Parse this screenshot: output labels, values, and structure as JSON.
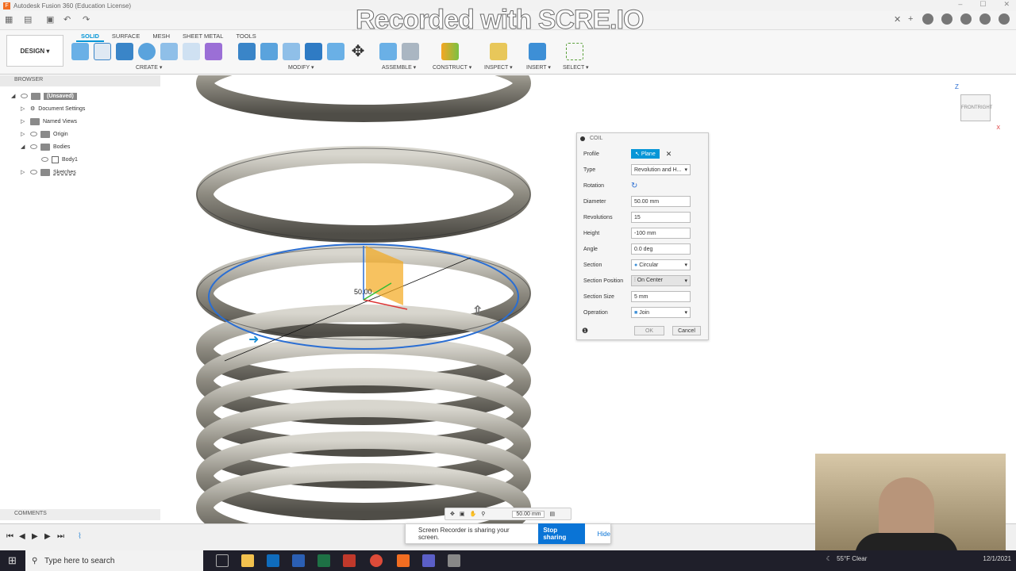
{
  "window": {
    "title": "Autodesk Fusion 360 (Education License)",
    "watermark": "Recorded with SCRE.IO"
  },
  "toolbar": {
    "workspace": "DESIGN ▾",
    "tabs": [
      "SOLID",
      "SURFACE",
      "MESH",
      "SHEET METAL",
      "TOOLS"
    ],
    "groups": [
      "CREATE ▾",
      "MODIFY ▾",
      "ASSEMBLE ▾",
      "CONSTRUCT ▾",
      "INSPECT ▾",
      "INSERT ▾",
      "SELECT ▾"
    ]
  },
  "browser": {
    "title": "BROWSER",
    "items": [
      "(Unsaved)",
      "Document Settings",
      "Named Views",
      "Origin",
      "Bodies",
      "Body1",
      "Sketches"
    ]
  },
  "comments": "COMMENTS",
  "viewcube": {
    "axis_z": "Z",
    "front": "FRONT",
    "right": "RIGHT",
    "axis_x": "X"
  },
  "canvas": {
    "dim_label": "50.00"
  },
  "navbar": {
    "value": "50.00 mm"
  },
  "coil": {
    "title": "COIL",
    "rows": [
      {
        "label": "Profile",
        "value": "Plane"
      },
      {
        "label": "Type",
        "value": "Revolution and H..."
      },
      {
        "label": "Rotation",
        "value": ""
      },
      {
        "label": "Diameter",
        "value": "50.00 mm"
      },
      {
        "label": "Revolutions",
        "value": "15"
      },
      {
        "label": "Height",
        "value": "-100 mm"
      },
      {
        "label": "Angle",
        "value": "0.0 deg"
      },
      {
        "label": "Section",
        "value": "Circular"
      },
      {
        "label": "Section Position",
        "value": "On Center"
      },
      {
        "label": "Section Size",
        "value": "5 mm"
      },
      {
        "label": "Operation",
        "value": "Join"
      }
    ],
    "ok": "OK",
    "cancel": "Cancel"
  },
  "share": {
    "message": "Screen Recorder is sharing your screen.",
    "stop": "Stop sharing",
    "hide": "Hide"
  },
  "taskbar": {
    "search": "Type here to search",
    "weather": "55°F Clear",
    "date": "12/1/2021"
  }
}
